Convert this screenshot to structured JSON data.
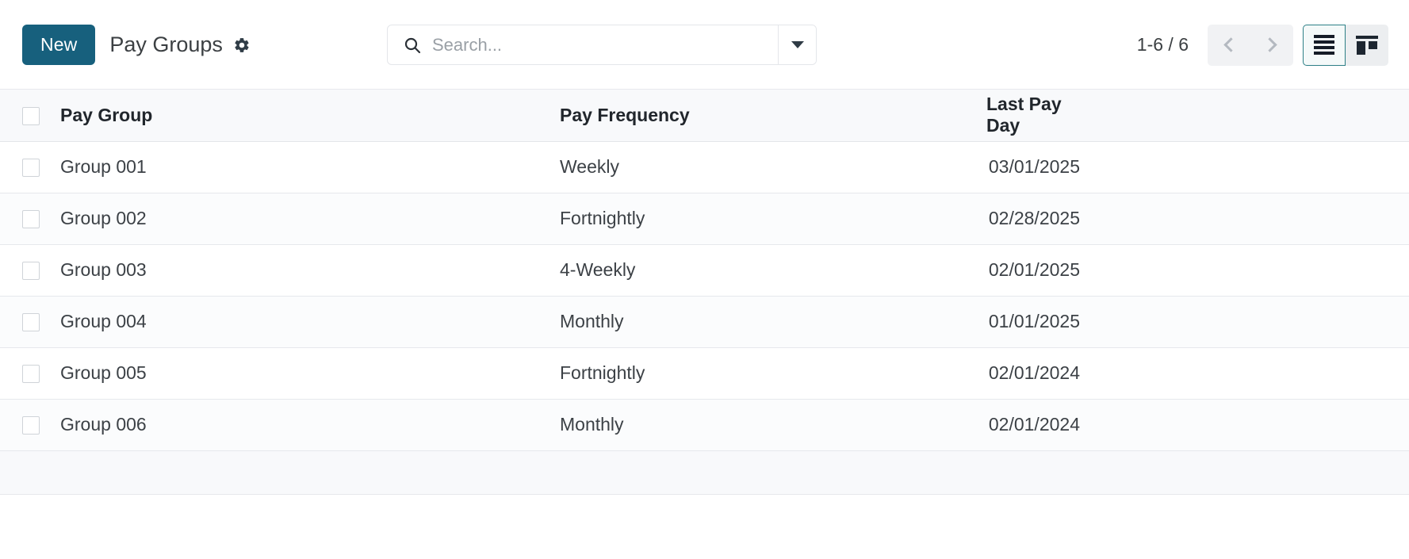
{
  "toolbar": {
    "new_label": "New",
    "page_title": "Pay Groups",
    "settings_icon": "gear-icon"
  },
  "search": {
    "placeholder": "Search...",
    "value": "",
    "icon": "search-icon",
    "toggle_icon": "chevron-down-icon"
  },
  "pager": {
    "range": "1-6 / 6",
    "prev_icon": "chevron-left-icon",
    "next_icon": "chevron-right-icon"
  },
  "views": [
    {
      "name": "list-view",
      "icon": "list-icon",
      "active": true
    },
    {
      "name": "kanban-view",
      "icon": "kanban-icon",
      "active": false
    }
  ],
  "colors": {
    "primary": "#17607d",
    "active_border": "#2d7f86",
    "header_bg": "#f8f9fb",
    "row_alt_bg": "#fbfcfd",
    "text": "#3c4146"
  },
  "table": {
    "columns": [
      {
        "key": "name",
        "label": "Pay Group"
      },
      {
        "key": "frequency",
        "label": "Pay Frequency"
      },
      {
        "key": "last_pay_day",
        "label": "Last Pay Day"
      }
    ],
    "rows": [
      {
        "name": "Group 001",
        "frequency": "Weekly",
        "last_pay_day": "03/01/2025"
      },
      {
        "name": "Group 002",
        "frequency": "Fortnightly",
        "last_pay_day": "02/28/2025"
      },
      {
        "name": "Group 003",
        "frequency": "4-Weekly",
        "last_pay_day": "02/01/2025"
      },
      {
        "name": "Group 004",
        "frequency": "Monthly",
        "last_pay_day": "01/01/2025"
      },
      {
        "name": "Group 005",
        "frequency": "Fortnightly",
        "last_pay_day": "02/01/2024"
      },
      {
        "name": "Group 006",
        "frequency": "Monthly",
        "last_pay_day": "02/01/2024"
      }
    ]
  }
}
